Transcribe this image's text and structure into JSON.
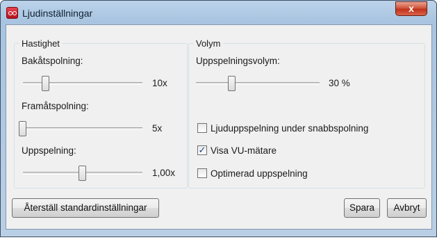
{
  "window": {
    "title": "Ljudinställningar",
    "close_glyph": "x"
  },
  "speed_group": {
    "title": "Hastighet",
    "rewind": {
      "label": "Bakåtspolning:",
      "value": "10x",
      "level": 0.18
    },
    "forward": {
      "label": "Framåtspolning:",
      "value": "5x",
      "level": 0.0
    },
    "playback": {
      "label": "Uppspelning:",
      "value": "1,00x",
      "level": 0.5
    }
  },
  "volume_group": {
    "title": "Volym",
    "playback_volume": {
      "label": "Uppspelningsvolym:",
      "value": "30 %",
      "level": 0.3
    },
    "options": [
      {
        "label": "Ljuduppspelning under snabbspolning",
        "checked": false
      },
      {
        "label": "Visa VU-mätare",
        "checked": true
      },
      {
        "label": "Optimerad uppspelning",
        "checked": false
      }
    ]
  },
  "buttons": {
    "reset": "Återställ standardinställningar",
    "save": "Spara",
    "cancel": "Avbryt"
  }
}
